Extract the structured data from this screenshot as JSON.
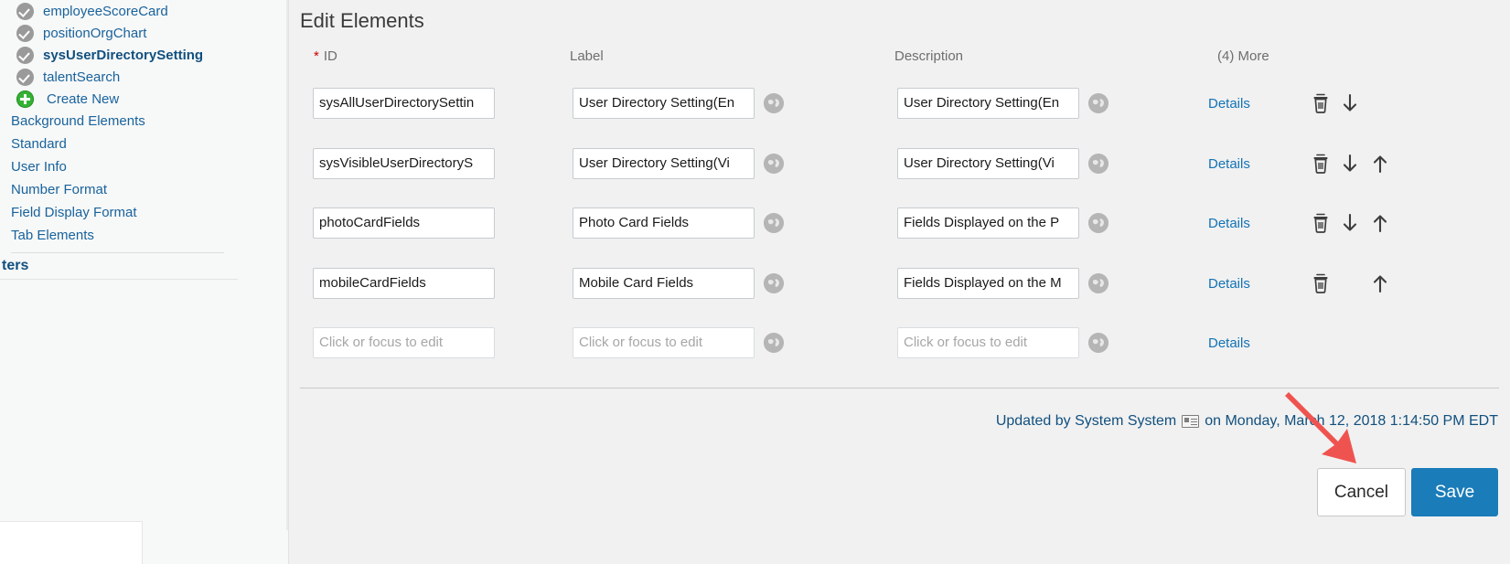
{
  "sidebar": {
    "tree_items": [
      {
        "label": "employeeScoreCard",
        "icon": "check-circle-icon",
        "bold": false
      },
      {
        "label": "positionOrgChart",
        "icon": "check-circle-icon",
        "bold": false
      },
      {
        "label": "sysUserDirectorySetting",
        "icon": "check-circle-icon",
        "bold": true
      },
      {
        "label": "talentSearch",
        "icon": "check-circle-icon",
        "bold": false
      },
      {
        "label": "Create New",
        "icon": "green-plus-icon",
        "bold": false
      }
    ],
    "section_links": [
      {
        "label": "Background Elements"
      },
      {
        "label": "Standard"
      },
      {
        "label": "User Info"
      },
      {
        "label": "Number Format"
      },
      {
        "label": "Field Display Format"
      },
      {
        "label": "Tab Elements"
      }
    ],
    "clipped_heading": "ters"
  },
  "main": {
    "title": "Edit Elements",
    "columns": {
      "id": "ID",
      "id_required_marker": "*",
      "label": "Label",
      "description": "Description",
      "more": "(4) More"
    },
    "details_label": "Details",
    "empty_placeholder": "Click or focus to edit",
    "rows": [
      {
        "id": "sysAllUserDirectorySettin",
        "label": "User Directory Setting(En",
        "description": "User Directory Setting(En",
        "details": "Details",
        "actions": [
          "trash-icon",
          "arrow-down-icon"
        ]
      },
      {
        "id": "sysVisibleUserDirectoryS",
        "label": "User Directory Setting(Vi",
        "description": "User Directory Setting(Vi",
        "details": "Details",
        "actions": [
          "trash-icon",
          "arrow-down-icon",
          "arrow-up-icon"
        ]
      },
      {
        "id": "photoCardFields",
        "label": "Photo Card Fields",
        "description": "Fields Displayed on the P",
        "details": "Details",
        "actions": [
          "trash-icon",
          "arrow-down-icon",
          "arrow-up-icon"
        ]
      },
      {
        "id": "mobileCardFields",
        "label": "Mobile Card Fields",
        "description": "Fields Displayed on the M",
        "details": "Details",
        "actions": [
          "trash-icon",
          "arrow-up-icon"
        ]
      },
      {
        "id": "",
        "label": "",
        "description": "",
        "details": "Details",
        "actions": []
      }
    ],
    "footer": {
      "updated_prefix": "Updated by System System",
      "updated_suffix": "on Monday, March 12, 2018 1:14:50 PM EDT"
    },
    "buttons": {
      "cancel": "Cancel",
      "save": "Save"
    }
  },
  "colors": {
    "link_blue": "#19639c",
    "details_blue": "#1273b5",
    "save_blue": "#1a7cb8",
    "required_red": "#cc0000",
    "annotation_red": "#ef5350",
    "panel_bg": "#f1f1f1",
    "sidebar_bg": "#f7f8f8"
  }
}
